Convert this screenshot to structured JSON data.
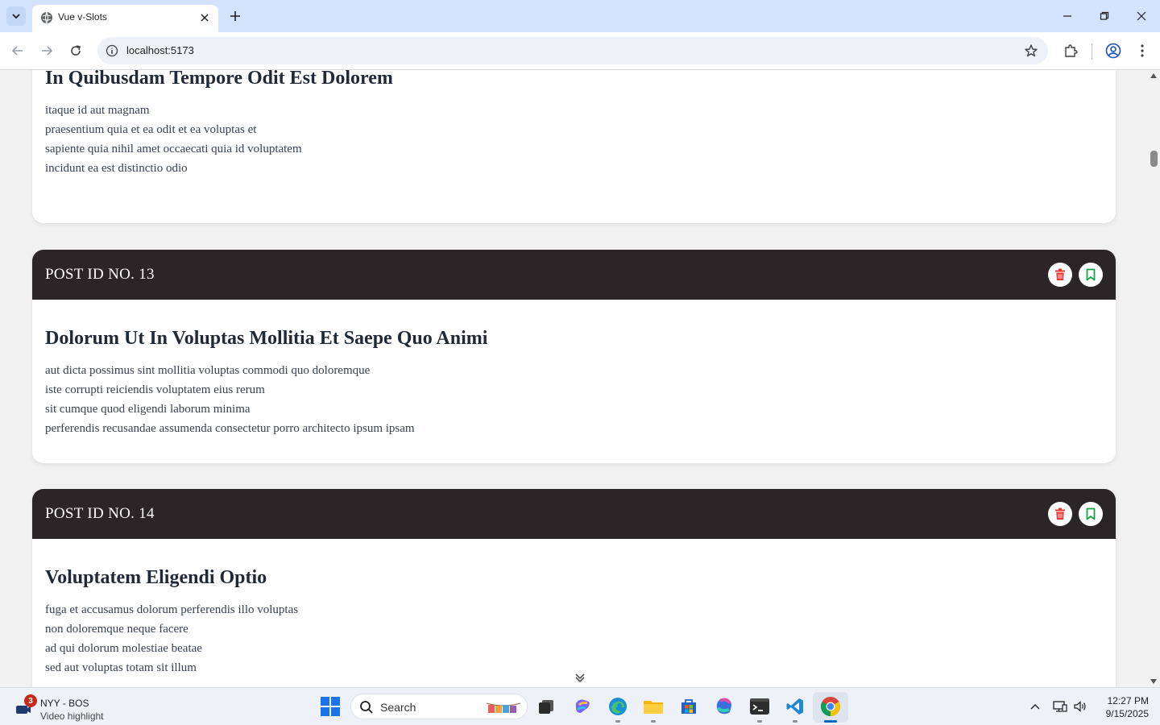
{
  "browser": {
    "tab_title": "Vue v-Slots",
    "url": "localhost:5173"
  },
  "posts": [
    {
      "id_label": "",
      "title": "In Quibusdam Tempore Odit Est Dolorem",
      "lines": [
        "itaque id aut magnam",
        "praesentium quia et ea odit et ea voluptas et",
        "sapiente quia nihil amet occaecati quia id voluptatem",
        "incidunt ea est distinctio odio"
      ]
    },
    {
      "id_label": "POST ID NO. 13",
      "title": "Dolorum Ut In Voluptas Mollitia Et Saepe Quo Animi",
      "lines": [
        "aut dicta possimus sint mollitia voluptas commodi quo doloremque",
        "iste corrupti reiciendis voluptatem eius rerum",
        "sit cumque quod eligendi laborum minima",
        "perferendis recusandae assumenda consectetur porro architecto ipsum ipsam"
      ]
    },
    {
      "id_label": "POST ID NO. 14",
      "title": "Voluptatem Eligendi Optio",
      "lines": [
        "fuga et accusamus dolorum perferendis illo voluptas",
        "non doloremque neque facere",
        "ad qui dolorum molestiae beatae",
        "sed aut voluptas totam sit illum"
      ]
    }
  ],
  "colors": {
    "header_bg": "#2a2527",
    "delete_red": "#e53935",
    "bookmark_green": "#16a34a"
  },
  "taskbar": {
    "weather_badge": "3",
    "weather_title": "NYY - BOS",
    "weather_subtitle": "Video highlight",
    "search_placeholder": "Search",
    "time": "12:27 PM",
    "date": "9/15/2025"
  }
}
